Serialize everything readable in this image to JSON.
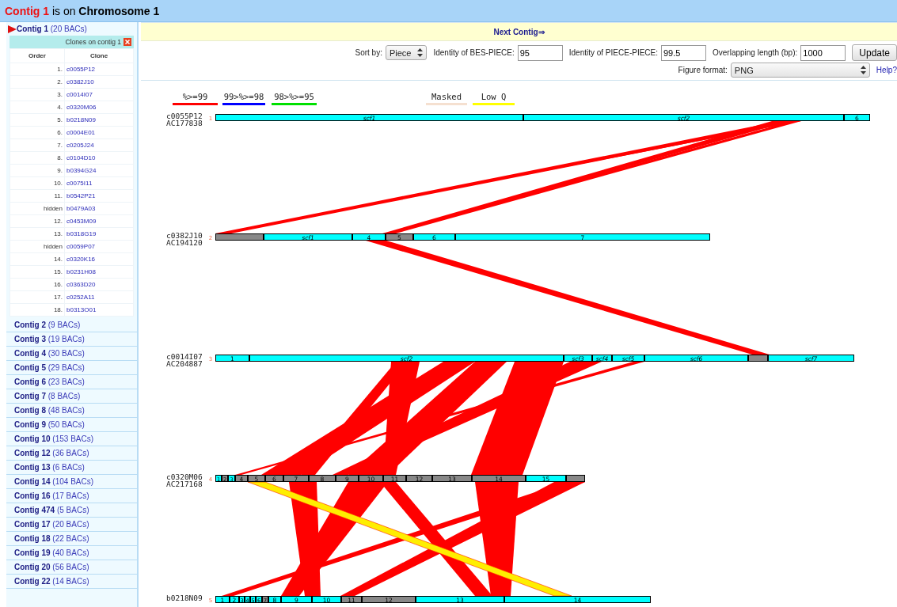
{
  "header": {
    "contig": "Contig 1",
    "middle": "is on",
    "chromosome": "Chromosome 1"
  },
  "sidebar": {
    "contigs": [
      {
        "name": "Contig 1",
        "count": "(20 BACs)",
        "expanded": true
      },
      {
        "name": "Contig 2",
        "count": "(9 BACs)",
        "expanded": false
      },
      {
        "name": "Contig 3",
        "count": "(19 BACs)",
        "expanded": false
      },
      {
        "name": "Contig 4",
        "count": "(30 BACs)",
        "expanded": false
      },
      {
        "name": "Contig 5",
        "count": "(29 BACs)",
        "expanded": false
      },
      {
        "name": "Contig 6",
        "count": "(23 BACs)",
        "expanded": false
      },
      {
        "name": "Contig 7",
        "count": "(8 BACs)",
        "expanded": false
      },
      {
        "name": "Contig 8",
        "count": "(48 BACs)",
        "expanded": false
      },
      {
        "name": "Contig 9",
        "count": "(50 BACs)",
        "expanded": false
      },
      {
        "name": "Contig 10",
        "count": "(153 BACs)",
        "expanded": false
      },
      {
        "name": "Contig 12",
        "count": "(36 BACs)",
        "expanded": false
      },
      {
        "name": "Contig 13",
        "count": "(6 BACs)",
        "expanded": false
      },
      {
        "name": "Contig 14",
        "count": "(104 BACs)",
        "expanded": false
      },
      {
        "name": "Contig 16",
        "count": "(17 BACs)",
        "expanded": false
      },
      {
        "name": "Contig 474",
        "count": "(5 BACs)",
        "expanded": false
      },
      {
        "name": "Contig 17",
        "count": "(20 BACs)",
        "expanded": false
      },
      {
        "name": "Contig 18",
        "count": "(22 BACs)",
        "expanded": false
      },
      {
        "name": "Contig 19",
        "count": "(40 BACs)",
        "expanded": false
      },
      {
        "name": "Contig 20",
        "count": "(56 BACs)",
        "expanded": false
      },
      {
        "name": "Contig 22",
        "count": "(14 BACs)",
        "expanded": false
      }
    ],
    "clones_panel": {
      "title": "Clones on contig 1",
      "columns": [
        "Order",
        "Clone"
      ],
      "rows": [
        {
          "order": "1.",
          "clone": "c0055P12"
        },
        {
          "order": "2.",
          "clone": "c0382J10"
        },
        {
          "order": "3.",
          "clone": "c0014I07"
        },
        {
          "order": "4.",
          "clone": "c0320M06"
        },
        {
          "order": "5.",
          "clone": "b0218N09"
        },
        {
          "order": "6.",
          "clone": "c0004E01"
        },
        {
          "order": "7.",
          "clone": "c0205J24"
        },
        {
          "order": "8.",
          "clone": "c0104D10"
        },
        {
          "order": "9.",
          "clone": "b0394G24"
        },
        {
          "order": "10.",
          "clone": "c0075I11"
        },
        {
          "order": "11.",
          "clone": "b0542P21"
        },
        {
          "order": "hidden",
          "clone": "b0479A03"
        },
        {
          "order": "12.",
          "clone": "c0453M09"
        },
        {
          "order": "13.",
          "clone": "b0318G19"
        },
        {
          "order": "hidden",
          "clone": "c0059P07"
        },
        {
          "order": "14.",
          "clone": "c0320K16"
        },
        {
          "order": "15.",
          "clone": "b0231H08"
        },
        {
          "order": "16.",
          "clone": "c0363D20"
        },
        {
          "order": "17.",
          "clone": "c0252A11"
        },
        {
          "order": "18.",
          "clone": "b0313O01"
        }
      ]
    }
  },
  "next_contig": "Next Contig⇒",
  "controls": {
    "sort_by": {
      "label": "Sort by:",
      "value": "Piece"
    },
    "fields": [
      {
        "label": "Identity of BES-PIECE:",
        "value": "95"
      },
      {
        "label": "Identity of PIECE-PIECE:",
        "value": "99.5"
      },
      {
        "label": "Overlapping length (bp):",
        "value": "1000"
      }
    ],
    "update": "Update",
    "figure_format": {
      "label": "Figure format:",
      "value": "PNG"
    },
    "help": "Help?"
  },
  "legend": [
    {
      "label": "%>=99",
      "color": "#ff0000"
    },
    {
      "label": "99>%>=98",
      "color": "#0000ff"
    },
    {
      "label": "98>%>=95",
      "color": "#00e000"
    },
    {
      "label": "Masked",
      "color": "#f5e0d0"
    },
    {
      "label": "Low Q",
      "color": "#ffff00"
    }
  ],
  "tracks": [
    {
      "number": "1",
      "clone": "c0055P12",
      "accession": "AC177838",
      "segments": [
        {
          "label": "scf1",
          "kind": "normal"
        },
        {
          "label": "scf2",
          "kind": "normal"
        },
        {
          "label": "6",
          "kind": "normal"
        }
      ]
    },
    {
      "number": "2",
      "clone": "c0382J10",
      "accession": "AC194120",
      "segments": [
        {
          "kind": "shaded"
        },
        {
          "label": "scf1",
          "kind": "normal"
        },
        {
          "label": "4",
          "kind": "normal"
        },
        {
          "label": "5",
          "kind": "shaded"
        },
        {
          "label": "6",
          "kind": "normal"
        },
        {
          "label": "7",
          "kind": "normal"
        }
      ]
    },
    {
      "number": "3",
      "clone": "c0014I07",
      "accession": "AC204887",
      "segments": [
        {
          "label": "1",
          "kind": "normal"
        },
        {
          "label": "scf2",
          "kind": "normal"
        },
        {
          "label": "scf3",
          "kind": "normal"
        },
        {
          "label": "scf4",
          "kind": "normal"
        },
        {
          "label": "scf5",
          "kind": "normal"
        },
        {
          "label": "scf6",
          "kind": "normal"
        },
        {
          "kind": "shaded"
        },
        {
          "label": "scf7",
          "kind": "normal"
        }
      ]
    },
    {
      "number": "4",
      "clone": "c0320M06",
      "accession": "AC217168",
      "segments": [
        {
          "label": "1",
          "kind": "normal"
        },
        {
          "label": "2",
          "kind": "shaded"
        },
        {
          "label": "3",
          "kind": "normal"
        },
        {
          "label": "4",
          "kind": "shaded"
        },
        {
          "label": "5",
          "kind": "shaded"
        },
        {
          "label": "6",
          "kind": "shaded"
        },
        {
          "label": "7",
          "kind": "shaded"
        },
        {
          "label": "8",
          "kind": "shaded"
        },
        {
          "label": "9",
          "kind": "shaded"
        },
        {
          "label": "10",
          "kind": "shaded"
        },
        {
          "label": "11",
          "kind": "shaded"
        },
        {
          "label": "12",
          "kind": "shaded"
        },
        {
          "label": "13",
          "kind": "shaded"
        },
        {
          "label": "14",
          "kind": "shaded"
        },
        {
          "label": "15",
          "kind": "normal"
        },
        {
          "kind": "shaded"
        }
      ]
    },
    {
      "number": "5",
      "clone": "b0218N09",
      "segments": [
        {
          "label": "1",
          "kind": "normal"
        },
        {
          "label": "2",
          "kind": "normal"
        },
        {
          "label": "3",
          "kind": "normal"
        },
        {
          "label": "4",
          "kind": "normal"
        },
        {
          "label": "5",
          "kind": "normal"
        },
        {
          "label": "6",
          "kind": "normal"
        },
        {
          "label": "7",
          "kind": "shaded"
        },
        {
          "label": "8",
          "kind": "normal"
        },
        {
          "label": "9",
          "kind": "normal"
        },
        {
          "label": "10",
          "kind": "normal"
        },
        {
          "label": "11",
          "kind": "shaded"
        },
        {
          "label": "12",
          "kind": "shaded"
        },
        {
          "label": "13",
          "kind": "normal"
        },
        {
          "label": "14",
          "kind": "normal"
        }
      ]
    }
  ]
}
